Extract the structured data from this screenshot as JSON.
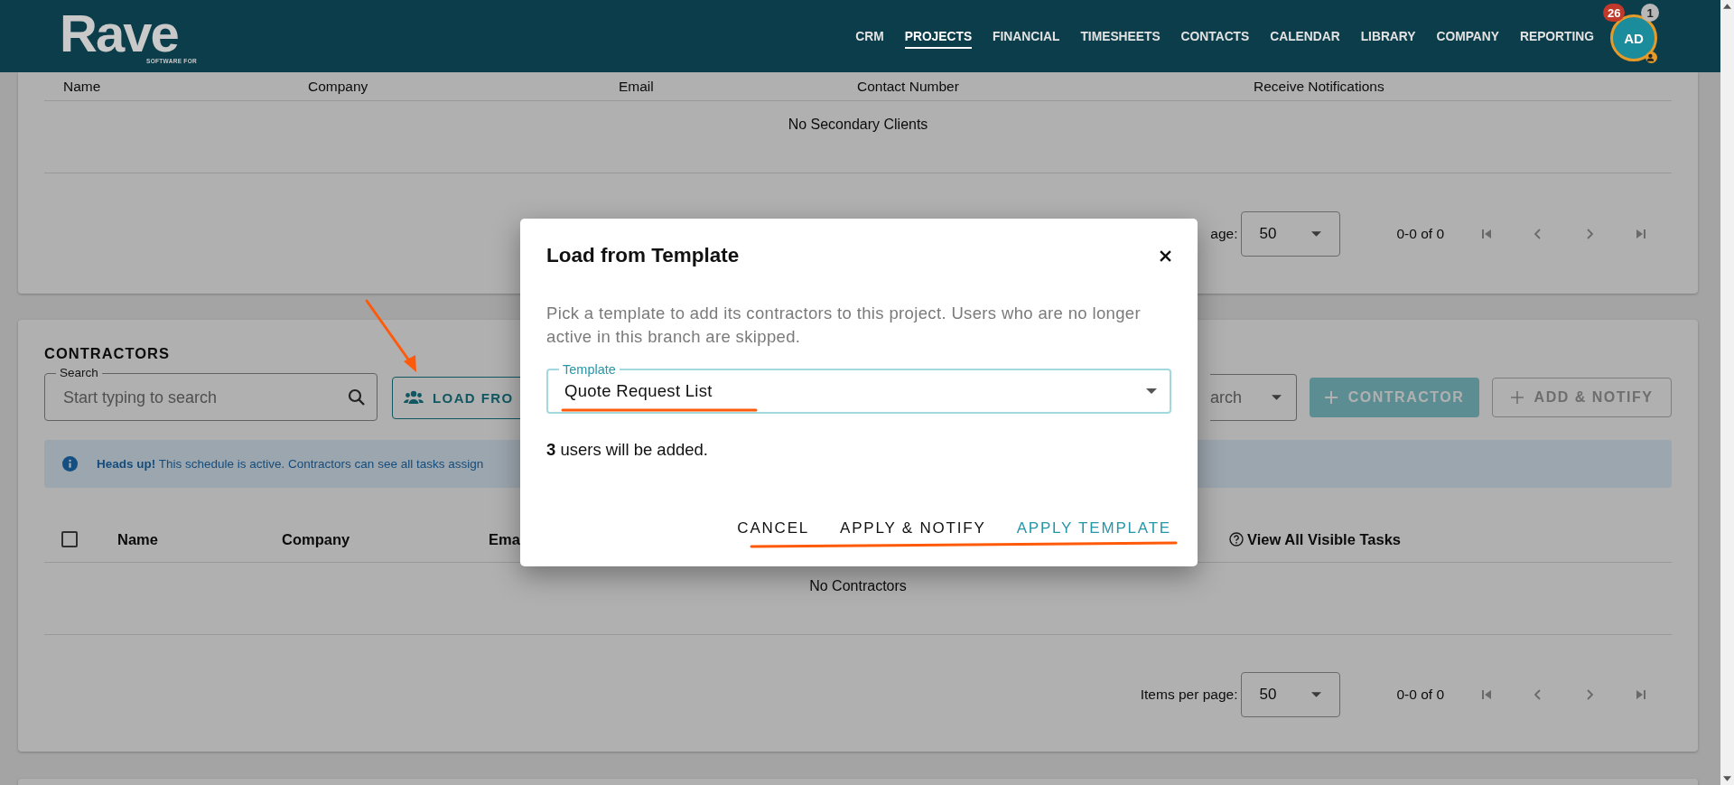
{
  "header": {
    "logo": "Rave",
    "logo_tagline": "SOFTWARE FOR",
    "nav": [
      {
        "label": "CRM",
        "selected": false
      },
      {
        "label": "PROJECTS",
        "selected": true
      },
      {
        "label": "FINANCIAL",
        "selected": false
      },
      {
        "label": "TIMESHEETS",
        "selected": false
      },
      {
        "label": "CONTACTS",
        "selected": false
      },
      {
        "label": "CALENDAR",
        "selected": false
      },
      {
        "label": "LIBRARY",
        "selected": false
      },
      {
        "label": "COMPANY",
        "selected": false
      },
      {
        "label": "REPORTING",
        "selected": false
      }
    ],
    "avatar": {
      "initials": "AD",
      "badges": [
        {
          "count": "26",
          "color": "#c0392b"
        },
        {
          "count": "1",
          "color": "#b8b8b8"
        }
      ]
    }
  },
  "secondary_clients": {
    "columns": [
      "Name",
      "Company",
      "Email",
      "Contact Number",
      "Receive Notifications"
    ],
    "empty_message": "No Secondary Clients",
    "paginator": {
      "label": "age:",
      "page_size": "50",
      "range": "0-0 of 0"
    }
  },
  "contractors": {
    "title": "CONTRACTORS",
    "search": {
      "label": "Search",
      "placeholder": "Start typing to search"
    },
    "load_button": "LOAD FRO",
    "filter_placeholder": "arch",
    "add_button": "CONTRACTOR",
    "add_notify_button": "ADD & NOTIFY",
    "notice": "**Heads up!** This schedule is active. Contractors can see all tasks assign",
    "select_all_checked": false,
    "columns": [
      "Name",
      "Company",
      "Ema"
    ],
    "view_tasks": "View All Visible Tasks",
    "empty_message": "No Contractors",
    "paginator": {
      "label": "Items per page:",
      "page_size": "50",
      "range": "0-0 of 0"
    }
  },
  "dialog": {
    "title": "Load from Template",
    "description": "Pick a template to add its contractors to this project. Users who are no longer active in this branch are skipped.",
    "field": {
      "label": "Template",
      "value": "Quote Request List"
    },
    "summary": "**3** users will be added.",
    "actions": [
      {
        "label": "CANCEL",
        "kind": "plain"
      },
      {
        "label": "APPLY & NOTIFY",
        "kind": "plain"
      },
      {
        "label": "APPLY TEMPLATE",
        "kind": "primary"
      }
    ]
  }
}
